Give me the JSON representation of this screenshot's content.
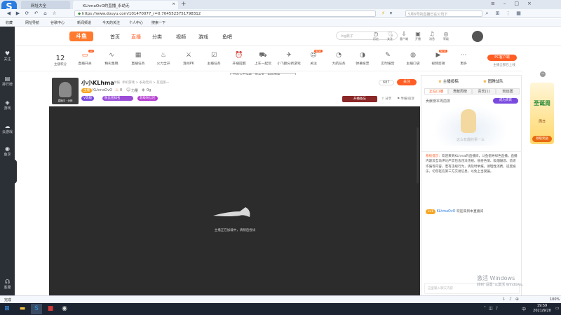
{
  "browser": {
    "tabs": [
      {
        "label": "网址大全"
      },
      {
        "label": "KLhmaOvO的直播_永劫无"
      }
    ],
    "url": "https://www.douyu.com/101470077_r=0.7045523751798312",
    "search_placeholder": "5月6号的直播已在公司下",
    "bookmarks": [
      "收藏",
      "网址导航",
      "谷歌中心",
      "新闻频道",
      "今天的关注",
      "个人中心",
      "搜索一下"
    ]
  },
  "left_sidebar": {
    "items": [
      {
        "label": "关注",
        "icon": "heart-icon"
      },
      {
        "label": "排行榜",
        "icon": "list-icon"
      },
      {
        "label": "游戏",
        "icon": "gamepad-icon"
      },
      {
        "label": "云游戏",
        "icon": "cloud-icon"
      },
      {
        "label": "鱼享",
        "icon": "fish-icon"
      },
      {
        "label": "客服",
        "icon": "headset-icon"
      }
    ]
  },
  "site_header": {
    "logo": "斗鱼",
    "nav": [
      "首页",
      "直播",
      "分类",
      "视频",
      "游戏",
      "鱼吧"
    ],
    "search_placeholder": "lng鼎子",
    "right_icons": [
      {
        "label": "历史",
        "icon": "clock-icon"
      },
      {
        "label": "关注",
        "icon": "heart-icon"
      },
      {
        "label": "客户端",
        "icon": "download-icon"
      },
      {
        "label": "开播",
        "icon": "camera-icon"
      },
      {
        "label": "消息",
        "icon": "bell-icon"
      },
      {
        "label": "等级",
        "icon": "shield-icon"
      }
    ]
  },
  "category_bar": {
    "rank_number": "12",
    "rank_label": "主播积分",
    "items": [
      {
        "label": "直播开关",
        "icon": "toggle-icon",
        "badge": "Lv"
      },
      {
        "label": "精彩集锦",
        "icon": "wave-icon"
      },
      {
        "label": "直播任务",
        "icon": "task-icon"
      },
      {
        "label": "火力全开",
        "icon": "fire-icon"
      },
      {
        "label": "连线PK",
        "icon": "pk-icon"
      },
      {
        "label": "主播任务",
        "icon": "check-icon"
      },
      {
        "label": "开播提醒",
        "icon": "alarm-icon"
      },
      {
        "label": "上车一起玩",
        "icon": "car-icon"
      },
      {
        "label": "小飞翻分新游戏",
        "icon": "plane-icon"
      },
      {
        "label": "关注",
        "icon": "users-icon",
        "badge": "NEW"
      },
      {
        "label": "大航任务",
        "icon": "ship-icon"
      },
      {
        "label": "弹幕投票",
        "icon": "vote-icon"
      },
      {
        "label": "实时报告",
        "icon": "edit-icon"
      },
      {
        "label": "主播口袋",
        "icon": "pocket-icon"
      },
      {
        "label": "视频剪辑",
        "icon": "video-icon",
        "badge": "NEW"
      },
      {
        "label": "更多",
        "icon": "more-icon"
      }
    ],
    "pc_button": "PC客户端",
    "pc_sub": "主播全部已上线",
    "tooltip": "开启上车功能，带水友一起玩游戏~"
  },
  "room": {
    "streamer_name": "小小KLhma",
    "report": "举报",
    "category_path": "手机游戏 > 永劫无间 > 友谊第一",
    "avatar_tag": "直播中 · 全网",
    "owner_badge": "主播",
    "owner_name": "KLhmaOvO",
    "hot_value": "0",
    "fans": "力量",
    "gifts": "0g",
    "level_pill": "V等级",
    "pill1": "粉丝团排名",
    "pill2": "超级粉丝团",
    "follow_btn": "关注",
    "follow_count": "687",
    "share": "分享",
    "report2": "举报/投诉",
    "action_btn": "开播备忘",
    "loading_text": "主播正在加载中，请稍后尝试"
  },
  "chat": {
    "top_tabs": [
      "主播投稿",
      "图腾战队"
    ],
    "tabs": [
      "正在口播",
      "贡献周榜",
      "贵宾(1)",
      "粉丝团"
    ],
    "rank_title": "贡献榜本周前排",
    "rank_btn": "成为贵宾",
    "empty_text": "这么有趣的事一么",
    "system_tag": "系统提示：",
    "system_msg": "欢迎来到KLhma的直播间，斗鱼倡导绿色直播，直播内容及互动评论严禁包含违法违规、低俗色情、吸烟酗酒、造谣诈骗等内容，若有违规行为，请及时举报。请理性消费，适度娱乐，切勿轻信第三方交易信息，以免上当受骗。",
    "welcome_level": "Lv1",
    "welcome_user": "KLhmaOvO",
    "welcome_text": "欢迎来到本直播间",
    "input_placeholder": "这里输入聊天内容"
  },
  "right_promo": {
    "title": "圣诞周",
    "btn": "领取奖励",
    "sub": "周日"
  },
  "status": {
    "left": "完成",
    "zoom": "100%"
  },
  "windows": {
    "watermark_title": "激活 Windows",
    "watermark_sub": "转到“设置”以激活 Windows。",
    "time": "19:59",
    "date": "2021/9/20",
    "lang": "中"
  },
  "colors": {
    "accent": "#ff5d23",
    "player_bg": "#2c2c2c",
    "sidebar_bg": "#2b2f36",
    "taskbar_bg": "#1c2331"
  }
}
